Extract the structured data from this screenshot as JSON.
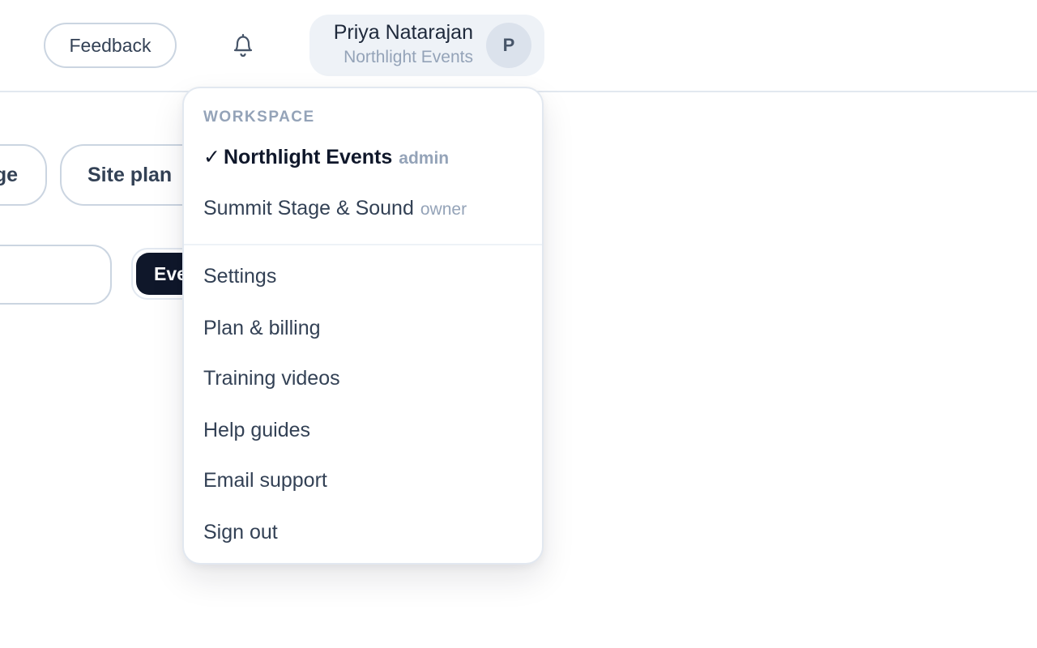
{
  "header": {
    "feedback_label": "Feedback",
    "notifications_icon": "bell-icon",
    "user": {
      "name": "Priya Natarajan",
      "organization": "Northlight Events",
      "avatar_initial": "P"
    }
  },
  "background": {
    "tab_partial_label": "ge",
    "tab_site_plan_label": "Site plan",
    "dark_chip_label": "Eve"
  },
  "account_menu": {
    "section_label": "WORKSPACE",
    "workspaces": [
      {
        "check": "✓",
        "name": "Northlight Events",
        "role": "admin",
        "active": true
      },
      {
        "name": "Summit Stage & Sound",
        "role": "owner",
        "active": false
      }
    ],
    "items": [
      {
        "label": "Settings"
      },
      {
        "label": "Plan & billing"
      },
      {
        "label": "Training videos"
      },
      {
        "label": "Help guides"
      },
      {
        "label": "Email support"
      },
      {
        "label": "Sign out"
      }
    ]
  },
  "colors": {
    "text_primary": "#0f172a",
    "text_secondary": "#334155",
    "text_muted": "#94a3b8",
    "border": "#cbd5e1",
    "chip_bg": "#eef2f7",
    "dark_chip": "#0f172a"
  }
}
